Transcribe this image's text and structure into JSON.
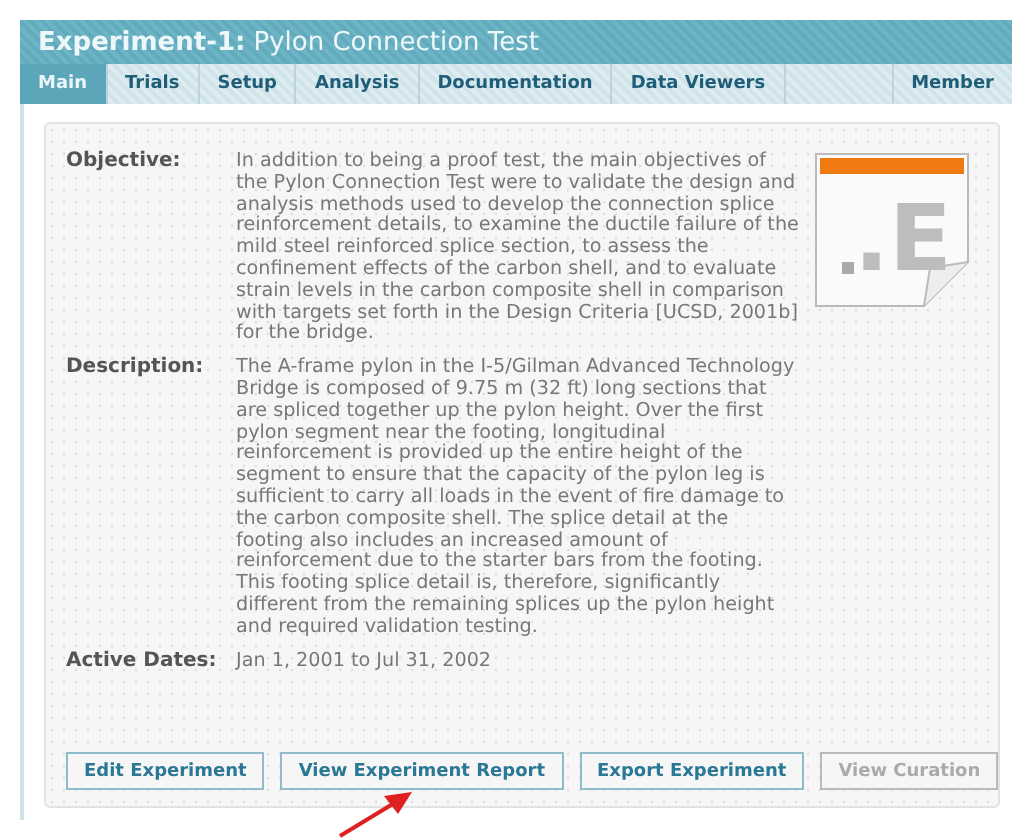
{
  "header": {
    "title_prefix": "Experiment-1:",
    "title": "Pylon Connection Test"
  },
  "tabs": [
    {
      "label": "Main",
      "selected": true
    },
    {
      "label": "Trials",
      "selected": false
    },
    {
      "label": "Setup",
      "selected": false
    },
    {
      "label": "Analysis",
      "selected": false
    },
    {
      "label": "Documentation",
      "selected": false
    },
    {
      "label": "Data Viewers",
      "selected": false
    },
    {
      "label": "Member",
      "selected": false
    }
  ],
  "file_icon": {
    "label": ".E"
  },
  "fields": [
    {
      "label": "Objective:",
      "value": "In addition to being a proof test, the main objectives of the Pylon Connection Test were to validate the design and analysis methods used to develop the connection splice reinforcement details, to examine the ductile failure of the mild steel reinforced splice section, to assess the confinement effects of the carbon shell, and to evaluate strain levels in the carbon composite shell in comparison with targets set forth in the Design Criteria [UCSD, 2001b] for the bridge."
    },
    {
      "label": "Description:",
      "value": "The A-frame pylon in the I-5/Gilman Advanced Technology Bridge is composed of 9.75 m (32 ft) long sections that are spliced together up the pylon height. Over the first pylon segment near the footing, longitudinal reinforcement is provided up the entire height of the segment to ensure that the capacity of the pylon leg is sufficient to carry all loads in the event of fire damage to the carbon composite shell. The splice detail at the footing also includes an increased amount of reinforcement due to the starter bars from the footing. This footing splice detail is, therefore, significantly different from the remaining splices up the pylon height and required validation testing."
    },
    {
      "label": "Active Dates:",
      "value": "Jan 1, 2001 to Jul 31, 2002"
    }
  ],
  "buttons": [
    {
      "label": "Edit Experiment",
      "disabled": false
    },
    {
      "label": "View Experiment Report",
      "disabled": false
    },
    {
      "label": "Export Experiment",
      "disabled": false
    },
    {
      "label": "View Curation",
      "disabled": true
    }
  ]
}
